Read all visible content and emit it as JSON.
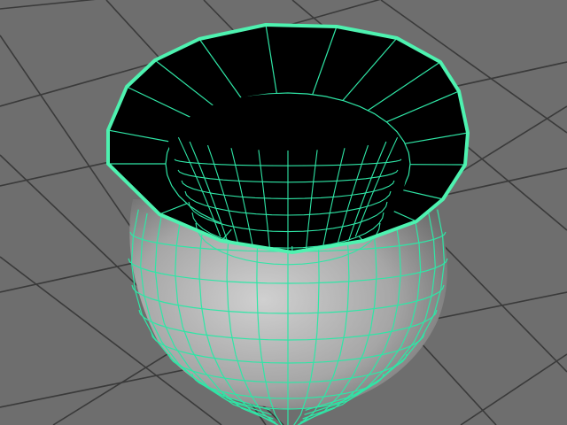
{
  "viewport": {
    "background": "#6e6e6e",
    "grid_color": "#3a3a3a",
    "selection_highlight": "#4ef2b0",
    "wireframe_color": "#2fe6a6",
    "body_shading": [
      "#a9a9a9",
      "#cfcfcf",
      "#5e5e5e"
    ],
    "rim_interior": "#000000",
    "object": {
      "icon": "pot-mesh-icon",
      "selected": true
    }
  }
}
